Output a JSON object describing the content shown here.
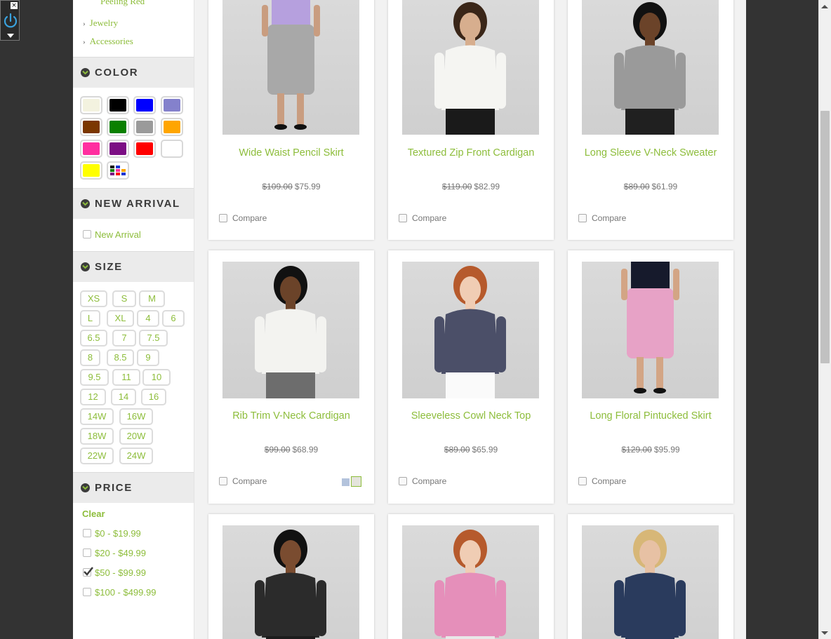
{
  "widget": {
    "close_glyph": "×"
  },
  "sidebar": {
    "categories_cut": "Peeling Red",
    "categories": [
      {
        "chevron": "›",
        "label": "Jewelry"
      },
      {
        "chevron": "›",
        "label": "Accessories"
      }
    ],
    "color": {
      "title": "COLOR",
      "swatches": [
        "#f3f2df",
        "#000000",
        "#0000ff",
        "#8481cc",
        "#7b3700",
        "#0a8000",
        "#9a9a9a",
        "#ffa500",
        "#ff2fa0",
        "#7c0e84",
        "#ff0000",
        "#ffffff",
        "#ffff00",
        "multicolor"
      ]
    },
    "new_arrival": {
      "title": "NEW ARRIVAL",
      "option": "New Arrival"
    },
    "size": {
      "title": "SIZE",
      "options": [
        "XS",
        "S",
        "M",
        "L",
        "XL",
        "4",
        "6",
        "6.5",
        "7",
        "7.5",
        "8",
        "8.5",
        "9",
        "9.5",
        "11",
        "10",
        "12",
        "14",
        "16",
        "14W",
        "16W",
        "18W",
        "20W",
        "22W",
        "24W"
      ]
    },
    "price": {
      "title": "PRICE",
      "clear": "Clear",
      "options": [
        {
          "label": "$0 - $19.99",
          "checked": false
        },
        {
          "label": "$20 - $49.99",
          "checked": false
        },
        {
          "label": "$50 - $99.99",
          "checked": true
        },
        {
          "label": "$100 - $499.99",
          "checked": false
        }
      ]
    }
  },
  "products": [
    {
      "name": "Wide Waist Pencil Skirt",
      "old_price": "$109.00",
      "price": "$75.99",
      "compare": "Compare",
      "image": "model-gray-pencil-skirt"
    },
    {
      "name": "Textured Zip Front Cardigan",
      "old_price": "$119.00",
      "price": "$82.99",
      "compare": "Compare",
      "image": "model-white-cardigan"
    },
    {
      "name": "Long Sleeve V-Neck Sweater",
      "old_price": "$89.00",
      "price": "$61.99",
      "compare": "Compare",
      "image": "model-gray-sweater"
    },
    {
      "name": "Rib Trim V-Neck Cardigan",
      "old_price": "$99.00",
      "price": "$68.99",
      "compare": "Compare",
      "image": "model-white-rib-cardigan",
      "swatches": [
        "#b3c3dc",
        "#e4e4dc"
      ]
    },
    {
      "name": "Sleeveless Cowl Neck Top",
      "old_price": "$89.00",
      "price": "$65.99",
      "compare": "Compare",
      "image": "model-cowl-neck-top"
    },
    {
      "name": "Long Floral Pintucked Skirt",
      "old_price": "$129.00",
      "price": "$95.99",
      "compare": "Compare",
      "image": "model-floral-skirt"
    },
    {
      "image": "model-zebra-top"
    },
    {
      "image": "model-pink-floral-top"
    },
    {
      "image": "model-navy-jacket"
    }
  ],
  "colors": {
    "accent": "#8dbd3b",
    "panel_bg": "#ebebeb",
    "page_bg": "#f2f2f2"
  }
}
